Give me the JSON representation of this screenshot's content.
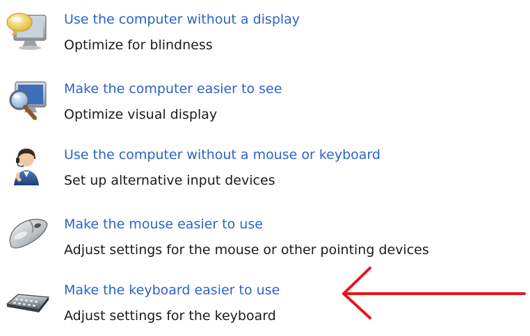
{
  "items": [
    {
      "icon": "narrator-speech-icon",
      "link": "Use the computer without a display",
      "description": "Optimize for blindness"
    },
    {
      "icon": "magnifier-icon",
      "link": "Make the computer easier to see",
      "description": "Optimize visual display"
    },
    {
      "icon": "headset-person-icon",
      "link": "Use the computer without a mouse or keyboard",
      "description": "Set up alternative input devices"
    },
    {
      "icon": "mouse-icon",
      "link": "Make the mouse easier to use",
      "description": "Adjust settings for the mouse or other pointing devices"
    },
    {
      "icon": "keyboard-icon",
      "link": "Make the keyboard easier to use",
      "description": "Adjust settings for the keyboard"
    }
  ],
  "annotation": {
    "icon": "red-arrow-icon",
    "color": "#e8141b"
  },
  "colors": {
    "link": "#2a63c7",
    "text": "#1a1a1a",
    "background": "#ffffff"
  }
}
